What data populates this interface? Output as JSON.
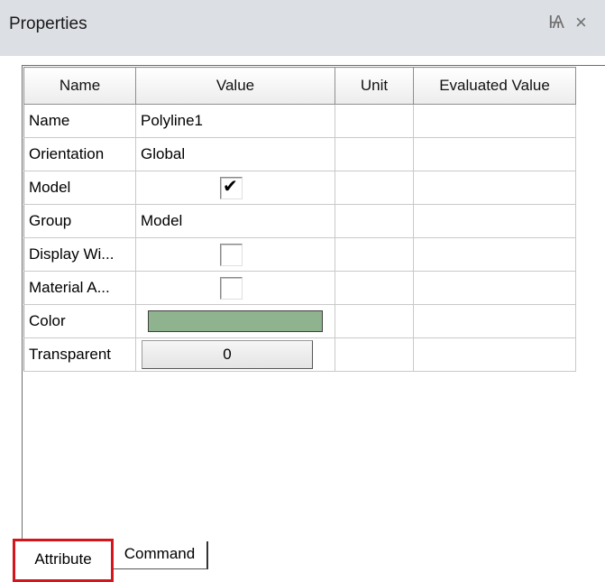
{
  "panel": {
    "title": "Properties",
    "pin_glyph": "Ѩ",
    "close_glyph": "×"
  },
  "table": {
    "headers": [
      "Name",
      "Value",
      "Unit",
      "Evaluated Value"
    ],
    "rows": [
      {
        "name": "Name",
        "value": "Polyline1",
        "kind": "text"
      },
      {
        "name": "Orientation",
        "value": "Global",
        "kind": "text"
      },
      {
        "name": "Model",
        "value": true,
        "kind": "checkbox"
      },
      {
        "name": "Group",
        "value": "Model",
        "kind": "text"
      },
      {
        "name": "Display Wi...",
        "value": false,
        "kind": "checkbox"
      },
      {
        "name": "Material A...",
        "value": false,
        "kind": "checkbox"
      },
      {
        "name": "Color",
        "value": "#8fb38f",
        "kind": "color"
      },
      {
        "name": "Transparent",
        "value": "0",
        "kind": "number"
      }
    ]
  },
  "tabs": {
    "attribute": "Attribute",
    "command": "Command"
  },
  "colors": {
    "highlight_border": "#d4161c",
    "swatch": "#8fb38f"
  }
}
